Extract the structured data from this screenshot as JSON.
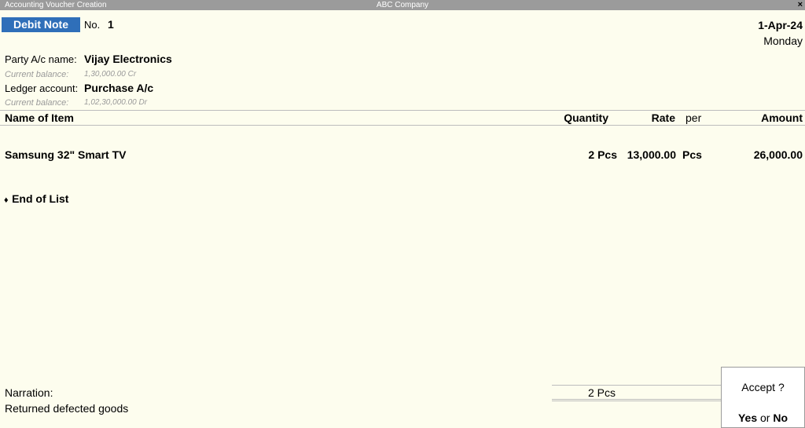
{
  "titlebar": {
    "window_title": "Accounting Voucher Creation",
    "company": "ABC Company",
    "close_glyph": "×"
  },
  "voucher": {
    "type": "Debit Note",
    "no_label": "No.",
    "number": "1",
    "date": "1-Apr-24",
    "day": "Monday"
  },
  "party": {
    "label": "Party A/c name:",
    "name": "Vijay Electronics",
    "balance_label": "Current balance:",
    "balance": "1,30,000.00 Cr"
  },
  "ledger": {
    "label": "Ledger account:",
    "name": "Purchase A/c",
    "balance_label": "Current balance:",
    "balance": "1,02,30,000.00 Dr"
  },
  "table": {
    "headers": {
      "item": "Name of Item",
      "quantity": "Quantity",
      "rate": "Rate",
      "per": "per",
      "amount": "Amount"
    },
    "rows": [
      {
        "item": "Samsung 32\" Smart TV",
        "quantity": "2 Pcs",
        "rate": "13,000.00",
        "per": "Pcs",
        "amount": "26,000.00"
      }
    ],
    "end_of_list": "End of List",
    "end_marker": "♦"
  },
  "narration": {
    "label": "Narration:",
    "text": "Returned defected goods"
  },
  "totals": {
    "quantity": "2 Pcs"
  },
  "accept_dialog": {
    "question": "Accept ?",
    "yes": "Yes",
    "or": "or",
    "no": "No"
  }
}
